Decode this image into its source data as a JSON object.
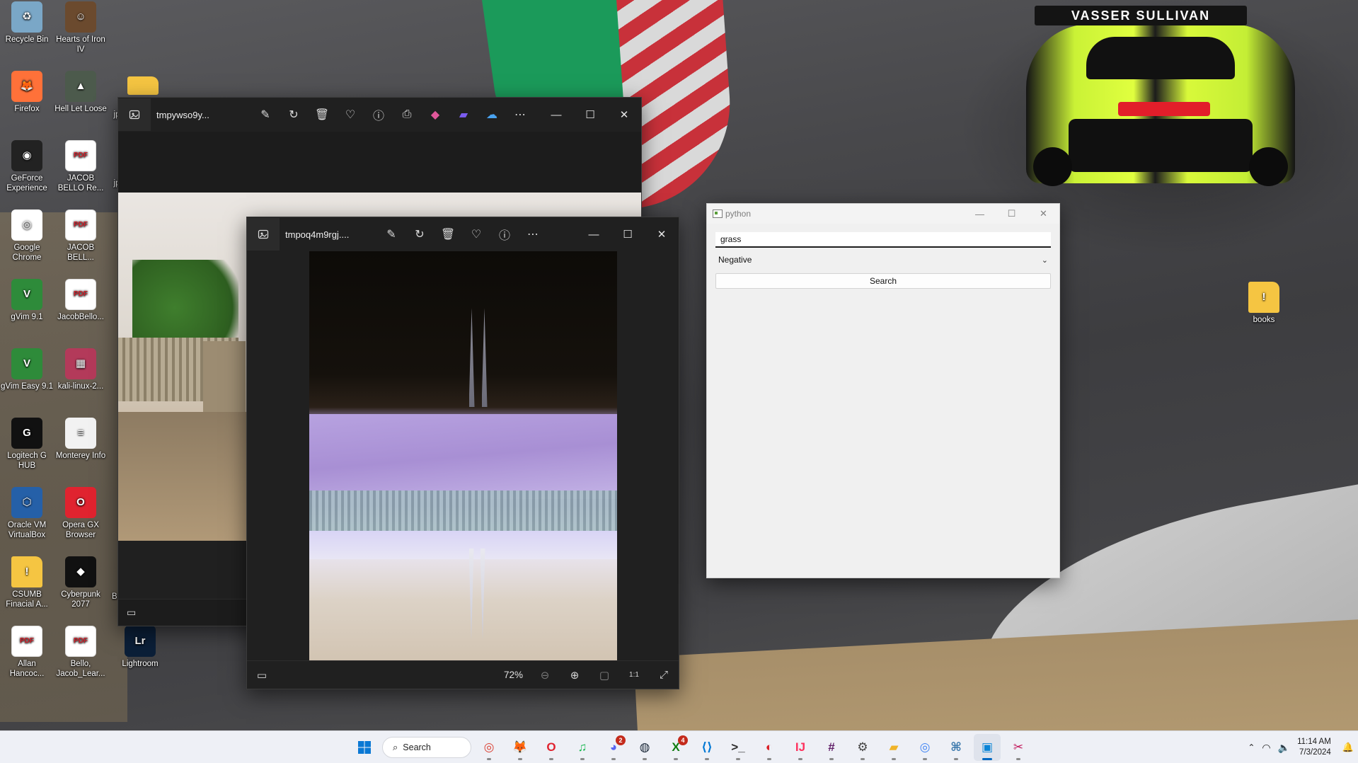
{
  "desktop": {
    "icons": [
      {
        "label": "Recycle Bin",
        "glyph": "♻"
      },
      {
        "label": "Hearts of Iron IV",
        "glyph": "☺"
      },
      {
        "label": "Firefox",
        "glyph": "🦊"
      },
      {
        "label": "Hell Let Loose",
        "glyph": "▲"
      },
      {
        "label": "GeForce Experience",
        "glyph": "◉"
      },
      {
        "label": "JACOB BELLO Re...",
        "glyph": "PDF"
      },
      {
        "label": "Google Chrome",
        "glyph": "◎"
      },
      {
        "label": "JACOB BELL...",
        "glyph": "PDF"
      },
      {
        "label": "gVim 9.1",
        "glyph": "V"
      },
      {
        "label": "JacobBello...",
        "glyph": "PDF"
      },
      {
        "label": "gVim Easy 9.1",
        "glyph": "V"
      },
      {
        "label": "kali-linux-2...",
        "glyph": "▦"
      },
      {
        "label": "Logitech G HUB",
        "glyph": "G"
      },
      {
        "label": "Monterey Info",
        "glyph": "≡"
      },
      {
        "label": "Oracle VM VirtualBox",
        "glyph": "⬡"
      },
      {
        "label": "Opera GX Browser",
        "glyph": "O"
      },
      {
        "label": "CSUMB Finacial A...",
        "glyph": "!"
      },
      {
        "label": "Cyberpunk 2077",
        "glyph": "◆"
      },
      {
        "label": "Allan Hancoc...",
        "glyph": "PDF"
      },
      {
        "label": "Bello, Jacob_Lear...",
        "glyph": "PDF"
      },
      {
        "label": "Lightroom",
        "glyph": "Lr"
      },
      {
        "label": "books",
        "glyph": "!"
      }
    ],
    "partial_labels": [
      "jp",
      "jp",
      "Be"
    ],
    "car_sponsor_text": "VASSER SULLIVAN"
  },
  "photos_back": {
    "title": "tmpywso9y...",
    "toolbar_icons": [
      "edit-icon",
      "rotate-icon",
      "delete-icon",
      "favorite-icon",
      "info-icon",
      "print-icon",
      "copilot-icon",
      "clipchamp-icon",
      "onedrive-icon",
      "more-icon"
    ]
  },
  "photos_front": {
    "title": "tmpoq4m9rgj....",
    "zoom": "72%"
  },
  "python_window": {
    "title": "python",
    "entry_value": "grass",
    "filter_selected": "Negative",
    "search_label": "Search"
  },
  "window_controls": {
    "minimize": "—",
    "maximize": "☐",
    "close": "✕"
  },
  "taskbar": {
    "search_label": "Search",
    "apps": [
      {
        "name": "chrome",
        "glyph": "◎",
        "color": "#db4437",
        "badge": ""
      },
      {
        "name": "firefox",
        "glyph": "🦊",
        "color": "#ff7139",
        "badge": ""
      },
      {
        "name": "opera",
        "glyph": "O",
        "color": "#e0232f",
        "badge": ""
      },
      {
        "name": "spotify",
        "glyph": "♫",
        "color": "#1db954",
        "badge": ""
      },
      {
        "name": "discord",
        "glyph": "◕",
        "color": "#5865f2",
        "badge": "2"
      },
      {
        "name": "steam",
        "glyph": "◍",
        "color": "#1b2838",
        "badge": ""
      },
      {
        "name": "xbox",
        "glyph": "X",
        "color": "#107c10",
        "badge": "4"
      },
      {
        "name": "vscode",
        "glyph": "⟨⟩",
        "color": "#0078d4",
        "badge": ""
      },
      {
        "name": "terminal",
        "glyph": ">_",
        "color": "#2b2b2b",
        "badge": ""
      },
      {
        "name": "creative-cloud",
        "glyph": "◐",
        "color": "#da1f26",
        "badge": ""
      },
      {
        "name": "intellij",
        "glyph": "IJ",
        "color": "#fe315d",
        "badge": ""
      },
      {
        "name": "slack",
        "glyph": "#",
        "color": "#611f69",
        "badge": ""
      },
      {
        "name": "settings",
        "glyph": "⚙",
        "color": "#444444",
        "badge": ""
      },
      {
        "name": "file-explorer",
        "glyph": "▰",
        "color": "#f0b429",
        "badge": ""
      },
      {
        "name": "chrome-profile",
        "glyph": "◎",
        "color": "#4285f4",
        "badge": ""
      },
      {
        "name": "python",
        "glyph": "⌘",
        "color": "#3776ab",
        "badge": ""
      },
      {
        "name": "photos",
        "glyph": "▣",
        "color": "#0a84d6",
        "badge": "",
        "active": true
      },
      {
        "name": "snipping-tool",
        "glyph": "✂",
        "color": "#c2185b",
        "badge": ""
      }
    ],
    "time": "11:14 AM",
    "date": "7/3/2024"
  }
}
